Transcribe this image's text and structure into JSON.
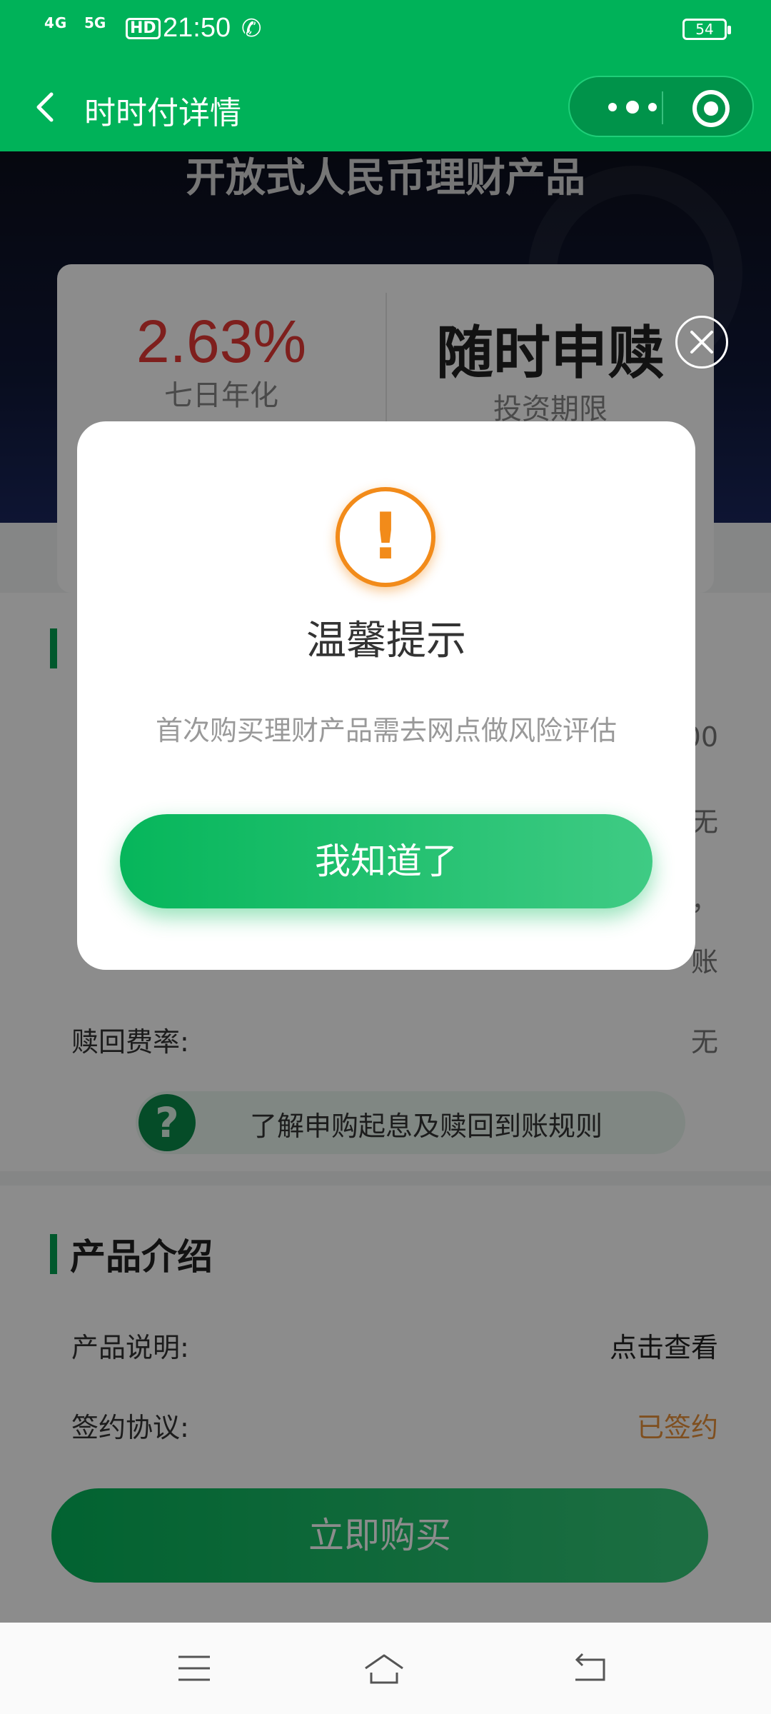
{
  "status": {
    "network1": "4G",
    "network2": "5G",
    "hd": "HD",
    "time": "21:50",
    "battery": "54"
  },
  "navbar": {
    "title": "时时付详情"
  },
  "hero": {
    "title": "开放式人民币理财产品"
  },
  "rates": {
    "annualized_value": "2.63%",
    "annualized_label": "七日年化",
    "term_value": "随时申赎",
    "term_label": "投资期限"
  },
  "section1": {
    "rows": [
      {
        "label": "",
        "value": "00"
      },
      {
        "label": "",
        "value": "无"
      },
      {
        "label": "",
        "value": "，"
      },
      {
        "label": "",
        "value": "账"
      },
      {
        "label": "赎回费率:",
        "value": "无"
      }
    ],
    "rules_text": "了解申购起息及赎回到账规则"
  },
  "section2": {
    "heading": "产品介绍",
    "rows": [
      {
        "label": "产品说明:",
        "value": "点击查看"
      },
      {
        "label": "签约协议:",
        "value": "已签约"
      }
    ]
  },
  "buy_button": "立即购买",
  "dialog": {
    "title": "温馨提示",
    "message": "首次购买理财产品需去网点做风险评估",
    "button": "我知道了"
  },
  "colors": {
    "brand_green": "#00b259",
    "rate_red": "#e53935",
    "warning_orange": "#f28b1a",
    "signed_orange": "#e8913a"
  }
}
